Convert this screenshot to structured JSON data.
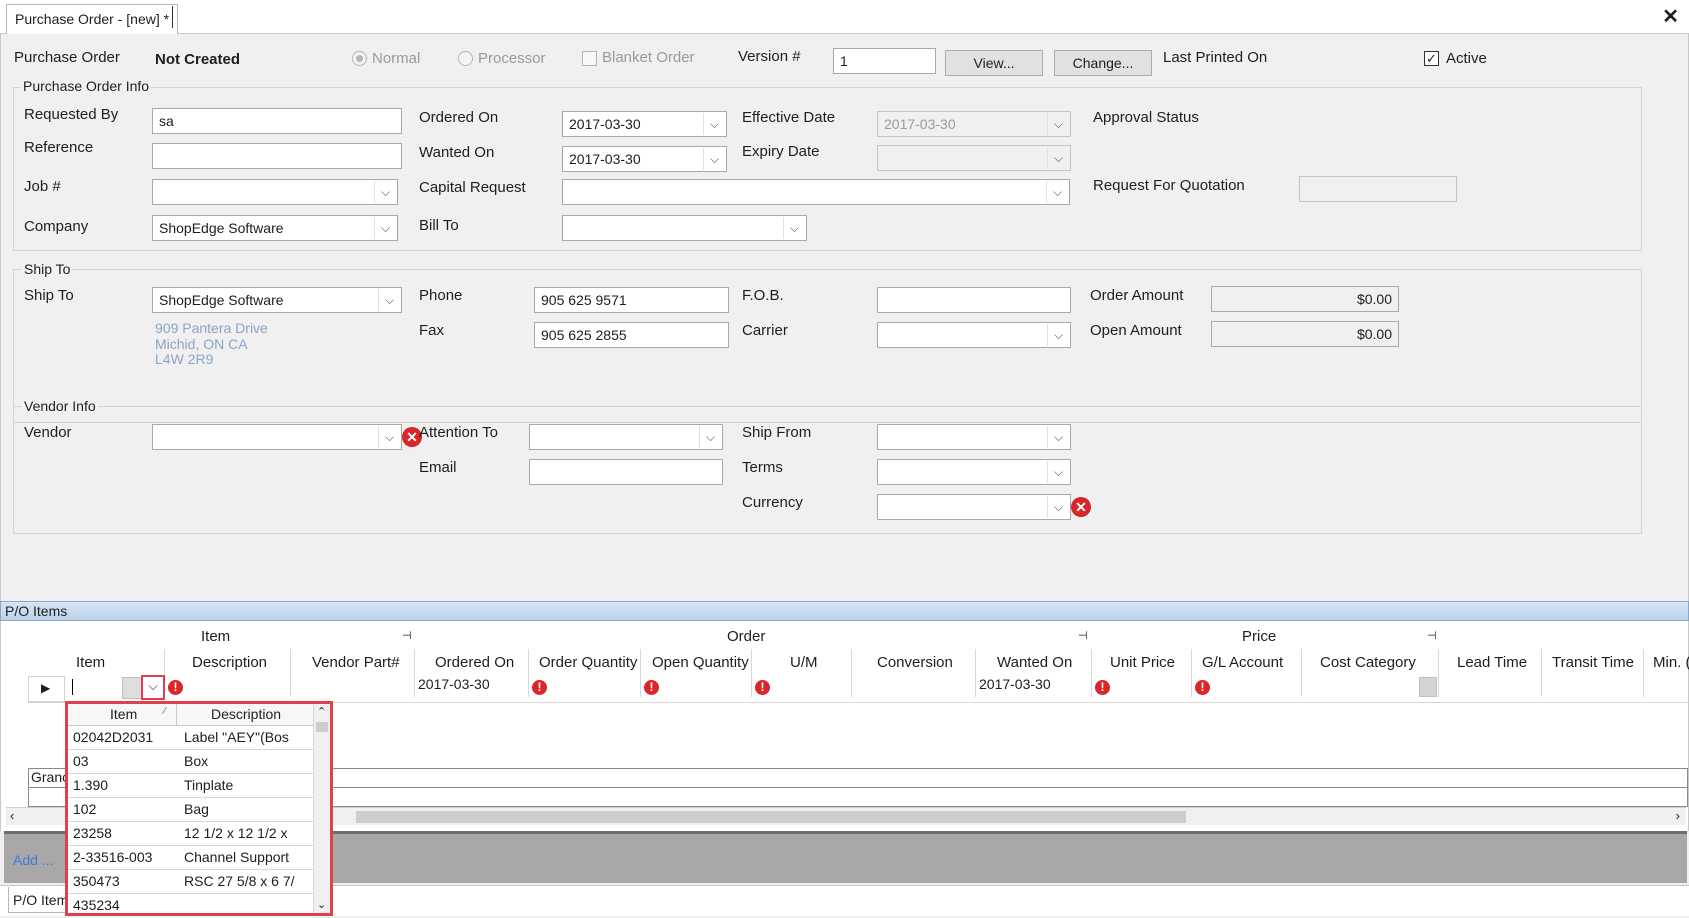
{
  "window": {
    "tab_title": "Purchase Order - [new] *",
    "close_icon": "close-icon"
  },
  "header": {
    "po_label": "Purchase Order",
    "po_status": "Not Created",
    "radio_normal": "Normal",
    "radio_processor": "Processor",
    "blanket_order": "Blanket Order",
    "version_label": "Version #",
    "version_value": "1",
    "view_button": "View...",
    "change_button": "Change...",
    "last_printed_label": "Last Printed On",
    "active_label": "Active"
  },
  "po_info": {
    "group_title": "Purchase Order Info",
    "requested_by_label": "Requested By",
    "requested_by_value": "sa",
    "reference_label": "Reference",
    "reference_value": "",
    "job_label": "Job #",
    "job_value": "",
    "company_label": "Company",
    "company_value": "ShopEdge Software",
    "ordered_on_label": "Ordered On",
    "ordered_on_value": "2017-03-30",
    "wanted_on_label": "Wanted On",
    "wanted_on_value": "2017-03-30",
    "capital_request_label": "Capital Request",
    "capital_request_value": "",
    "bill_to_label": "Bill To",
    "bill_to_value": "",
    "effective_date_label": "Effective Date",
    "effective_date_value": "2017-03-30",
    "expiry_date_label": "Expiry Date",
    "expiry_date_value": "",
    "approval_status_label": "Approval Status",
    "rfq_label": "Request For Quotation",
    "rfq_value": ""
  },
  "ship_to": {
    "group_title": "Ship To",
    "ship_to_label": "Ship To",
    "ship_to_value": "ShopEdge Software",
    "address_line1": "909 Pantera Drive",
    "address_line2": "Michid, ON CA",
    "address_line3": "L4W 2R9",
    "phone_label": "Phone",
    "phone_value": "905 625 9571",
    "fax_label": "Fax",
    "fax_value": "905 625 2855",
    "fob_label": "F.O.B.",
    "fob_value": "",
    "carrier_label": "Carrier",
    "carrier_value": "",
    "order_amount_label": "Order Amount",
    "order_amount_value": "$0.00",
    "open_amount_label": "Open Amount",
    "open_amount_value": "$0.00"
  },
  "vendor_info": {
    "group_title": "Vendor Info",
    "vendor_label": "Vendor",
    "vendor_value": "",
    "attention_label": "Attention To",
    "attention_value": "",
    "email_label": "Email",
    "email_value": "",
    "ship_from_label": "Ship From",
    "ship_from_value": "",
    "terms_label": "Terms",
    "terms_value": "",
    "currency_label": "Currency",
    "currency_value": ""
  },
  "items_panel": {
    "title": "P/O Items",
    "bands": {
      "item": "Item",
      "order": "Order",
      "price": "Price"
    },
    "columns": [
      "Item",
      "Description",
      "Vendor Part#",
      "Ordered On",
      "Order Quantity",
      "Open Quantity",
      "U/M",
      "Conversion",
      "Wanted On",
      "Unit Price",
      "G/L Account",
      "Cost Category",
      "Lead Time",
      "Transit Time",
      "Min. ("
    ],
    "row": {
      "ordered_on": "2017-03-30",
      "wanted_on": "2017-03-30"
    },
    "grand_label": "Granc",
    "add_label": "Add ...",
    "bottom_tab": "P/O Item"
  },
  "item_dropdown": {
    "col_item": "Item",
    "col_desc": "Description",
    "rows": [
      {
        "item": "02042D2031",
        "desc": "Label \"AEY\"(Bos"
      },
      {
        "item": "03",
        "desc": "Box"
      },
      {
        "item": "1.390",
        "desc": "Tinplate"
      },
      {
        "item": "102",
        "desc": "Bag"
      },
      {
        "item": "23258",
        "desc": "12 1/2 x 12 1/2 x"
      },
      {
        "item": "2-33516-003",
        "desc": "Channel Support"
      },
      {
        "item": "350473",
        "desc": "RSC 27 5/8 x 6 7/"
      },
      {
        "item": "435234",
        "desc": ""
      }
    ]
  },
  "colors": {
    "error": "#d9262a",
    "highlight": "#e0404c",
    "address_text": "#8ba4c9",
    "panel_header": "#bcd2ea"
  }
}
